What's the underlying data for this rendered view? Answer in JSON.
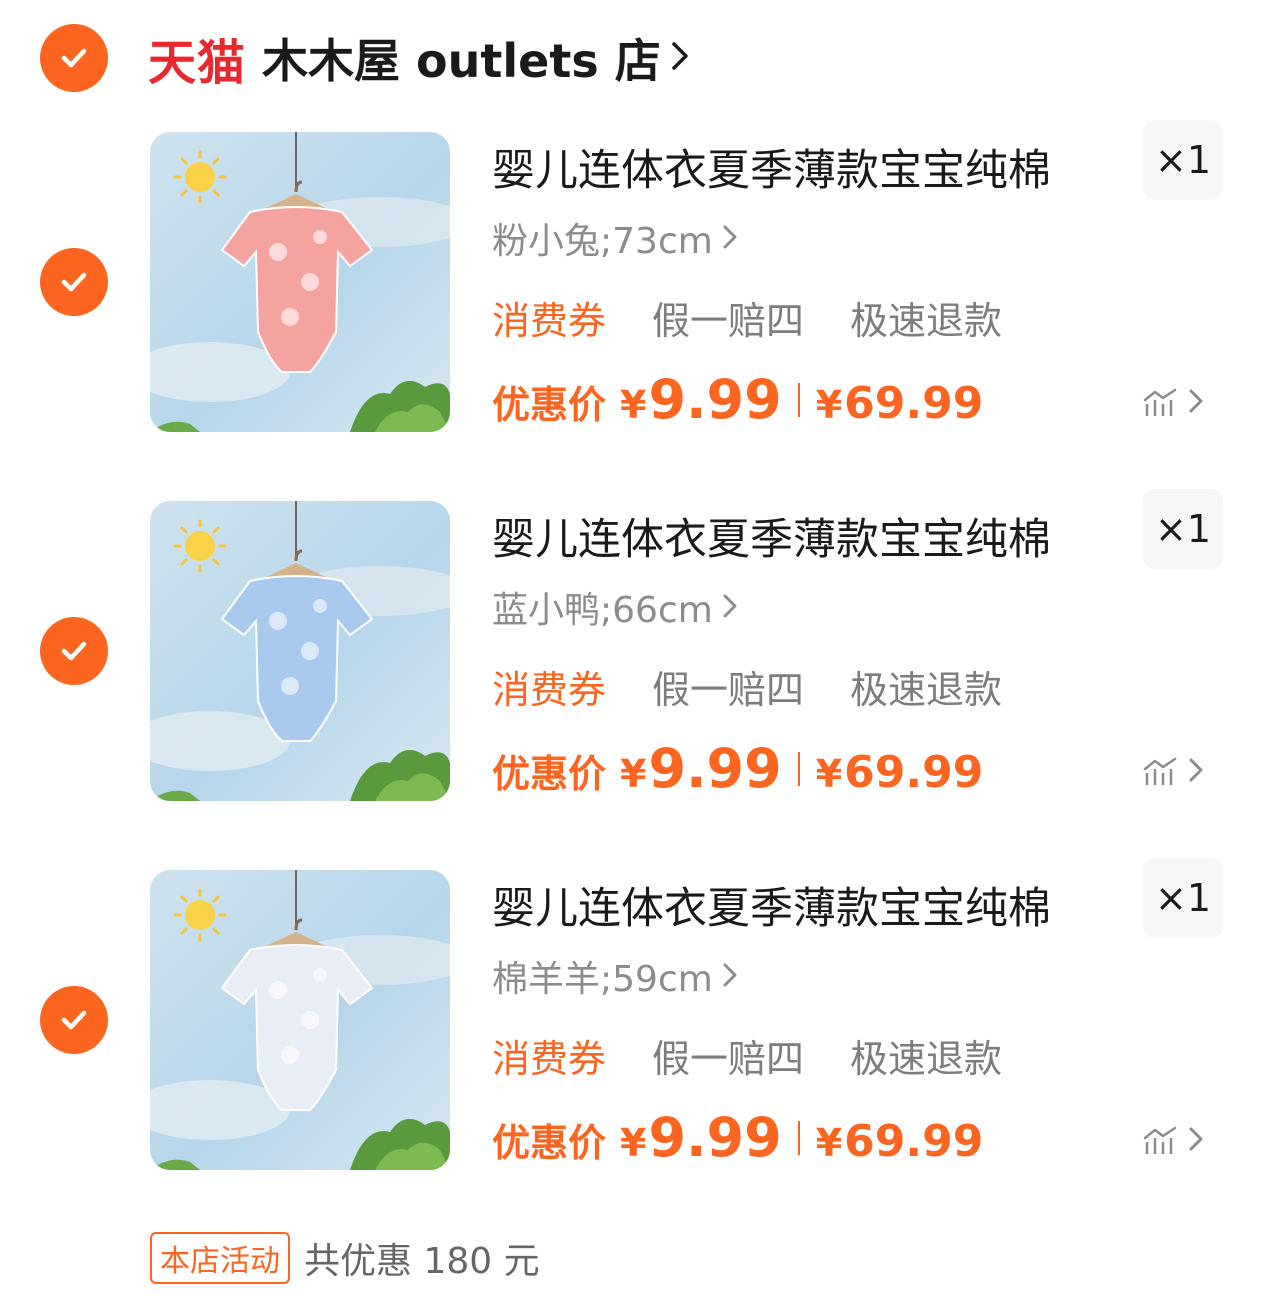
{
  "shop": {
    "platform": "天猫",
    "name": "木木屋 outlets 店"
  },
  "items": [
    {
      "title": "婴儿连体衣夏季薄款宝宝纯棉",
      "sku": "粉小兔;73cm",
      "quantity": "×1",
      "tags": [
        "消费券",
        "假一赔四",
        "极速退款"
      ],
      "price_label": "优惠价",
      "currency": "¥",
      "price": "9.99",
      "original_price": "69.99",
      "onesie_color": "#f4a3a0"
    },
    {
      "title": "婴儿连体衣夏季薄款宝宝纯棉",
      "sku": "蓝小鸭;66cm",
      "quantity": "×1",
      "tags": [
        "消费券",
        "假一赔四",
        "极速退款"
      ],
      "price_label": "优惠价",
      "currency": "¥",
      "price": "9.99",
      "original_price": "69.99",
      "onesie_color": "#a9c9ef"
    },
    {
      "title": "婴儿连体衣夏季薄款宝宝纯棉",
      "sku": "棉羊羊;59cm",
      "quantity": "×1",
      "tags": [
        "消费券",
        "假一赔四",
        "极速退款"
      ],
      "price_label": "优惠价",
      "currency": "¥",
      "price": "9.99",
      "original_price": "69.99",
      "onesie_color": "#e9eef6"
    }
  ],
  "footer": {
    "promo_badge": "本店活动",
    "promo_text": "共优惠 180 元"
  },
  "colors": {
    "accent": "#fb6520",
    "tmall_red": "#e8272e"
  },
  "icons": [
    "check-icon",
    "chevron-right-icon",
    "price-trend-icon"
  ]
}
